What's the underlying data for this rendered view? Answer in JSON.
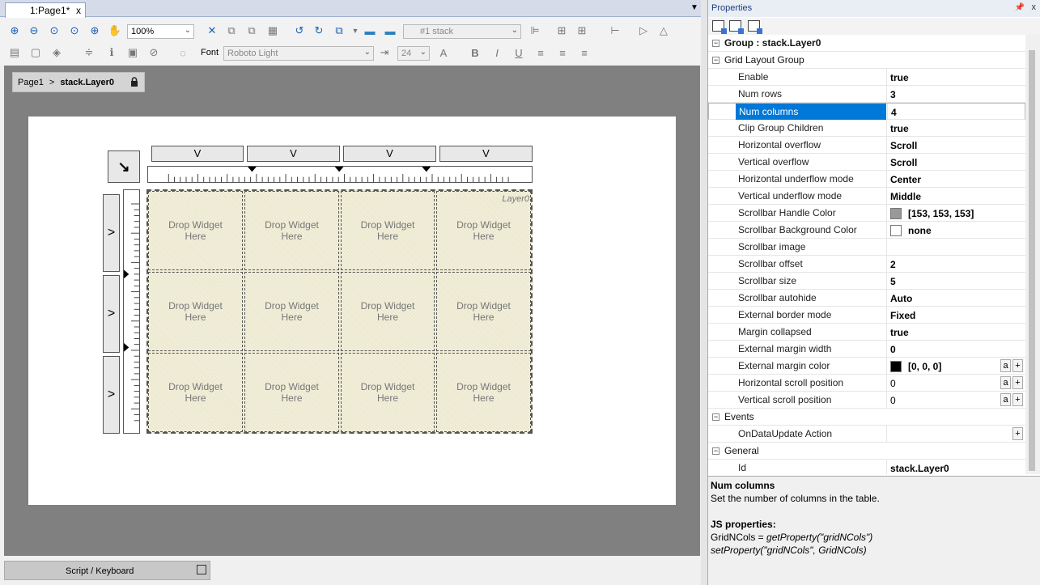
{
  "document": {
    "tab_label": "1:Page1*",
    "tab_close": "x",
    "zoom": "100%",
    "stack_select": "#1 stack",
    "font_label": "Font",
    "font_name": "Roboto Light",
    "font_size": "24"
  },
  "breadcrumb": {
    "page": "Page1",
    "separator": ">",
    "layer": "stack.Layer0"
  },
  "grid": {
    "layer_label": "Layer0",
    "cell_text": "Drop Widget\nHere",
    "col_header_glyph": "V",
    "row_header_glyph": ">",
    "corner_glyph": "↘"
  },
  "bottom_tab": {
    "label": "Script / Keyboard"
  },
  "properties": {
    "title": "Properties",
    "pin": "ᵠ",
    "close": "x",
    "rows": [
      {
        "type": "top",
        "name": "Group : stack.Layer0",
        "value": ""
      },
      {
        "type": "group",
        "name": "Grid Layout Group",
        "value": ""
      },
      {
        "type": "prop",
        "name": "Enable",
        "value": "true"
      },
      {
        "type": "prop",
        "name": "Num rows",
        "value": "3"
      },
      {
        "type": "prop",
        "name": "Num columns",
        "value": "4",
        "selected": true
      },
      {
        "type": "prop",
        "name": "Clip Group Children",
        "value": "true"
      },
      {
        "type": "prop",
        "name": "Horizontal overflow",
        "value": "Scroll"
      },
      {
        "type": "prop",
        "name": "Vertical overflow",
        "value": "Scroll"
      },
      {
        "type": "prop",
        "name": "Horizontal underflow mode",
        "value": "Center"
      },
      {
        "type": "prop",
        "name": "Vertical underflow mode",
        "value": "Middle"
      },
      {
        "type": "prop",
        "name": "Scrollbar Handle Color",
        "value": "[153, 153, 153]",
        "swatch": "#999999"
      },
      {
        "type": "prop",
        "name": "Scrollbar Background Color",
        "value": "none",
        "swatch": "#ffffff"
      },
      {
        "type": "prop",
        "name": "Scrollbar image",
        "value": ""
      },
      {
        "type": "prop",
        "name": "Scrollbar offset",
        "value": "2"
      },
      {
        "type": "prop",
        "name": "Scrollbar size",
        "value": "5"
      },
      {
        "type": "prop",
        "name": "Scrollbar autohide",
        "value": "Auto"
      },
      {
        "type": "prop",
        "name": "External border mode",
        "value": "Fixed"
      },
      {
        "type": "prop",
        "name": "Margin collapsed",
        "value": "true"
      },
      {
        "type": "prop",
        "name": "External margin width",
        "value": "0"
      },
      {
        "type": "prop",
        "name": "External margin color",
        "value": "[0, 0, 0]",
        "swatch": "#000000",
        "buttons": [
          "a",
          "+"
        ]
      },
      {
        "type": "prop",
        "name": "Horizontal scroll position",
        "value": "0",
        "plain": true,
        "buttons": [
          "a",
          "+"
        ]
      },
      {
        "type": "prop",
        "name": "Vertical scroll position",
        "value": "0",
        "plain": true,
        "buttons": [
          "a",
          "+"
        ]
      },
      {
        "type": "group",
        "name": "Events",
        "value": ""
      },
      {
        "type": "prop",
        "name": "OnDataUpdate Action",
        "value": "",
        "buttons": [
          "+"
        ]
      },
      {
        "type": "group",
        "name": "General",
        "value": ""
      },
      {
        "type": "prop",
        "name": "Id",
        "value": "stack.Layer0"
      }
    ]
  },
  "help": {
    "title": "Num columns",
    "description": "Set the number of columns in the table.",
    "js_title": "JS properties:",
    "getter_prefix": "GridNCols = ",
    "getter_call": "getProperty(\"gridNCols\")",
    "setter_call": "setProperty(\"gridNCols\", GridNCols)"
  },
  "colors": {
    "selection": "#0078d7",
    "grid_fill": "#ece9d0",
    "canvas_bg": "#808080"
  }
}
